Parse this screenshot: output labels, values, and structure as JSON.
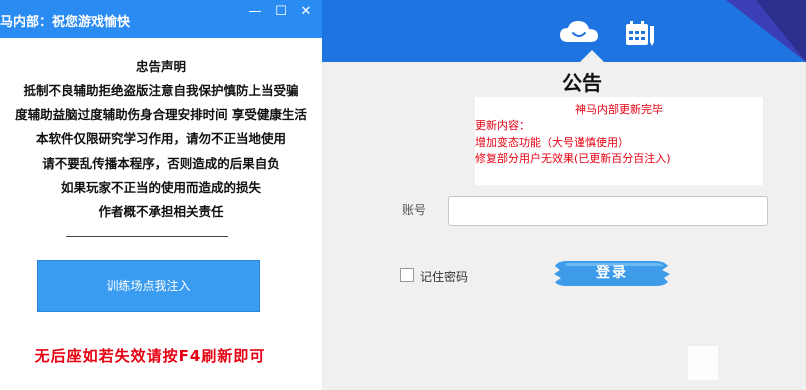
{
  "left_window": {
    "title": "马内部：祝您游戏愉快",
    "controls": {
      "minimize": "—",
      "maximize": "☐",
      "close": "✕"
    },
    "declaration": [
      "忠告声明",
      "抵制不良辅助拒绝盗版注意自我保护慎防上当受骗",
      "度辅助益脑过度辅助伤身合理安排时间  享受健康生活",
      "本软件仅限研究学习作用，请勿不正当地使用",
      "请不要乱传播本程序，否则造成的后果自负",
      "如果玩家不正当的使用而造成的损失",
      "作者概不承担相关责任"
    ],
    "inject_button": "训练场点我注入",
    "bottom_note": "无后座如若失效请按F4刷新即可"
  },
  "right_window": {
    "header_icons": [
      "cloud-icon",
      "calendar-icon"
    ],
    "notice_title": "公告",
    "notice": {
      "headline": "神马内部更新完毕",
      "lines": [
        "更新内容：",
        "增加变态功能（大号谨慎使用）",
        "修复部分用户无效果(已更新百分百注入)"
      ]
    },
    "account_label": "账号",
    "account_value": "",
    "remember_label": "记住密码",
    "remember_checked": false,
    "login_button": "登录"
  },
  "colors": {
    "title_bar": "#2a8bf2",
    "header_blue": "#1e74e0",
    "header_dark": "#2c2f8e",
    "notice_red": "#e60012",
    "button_blue": "#3a9cf0"
  }
}
